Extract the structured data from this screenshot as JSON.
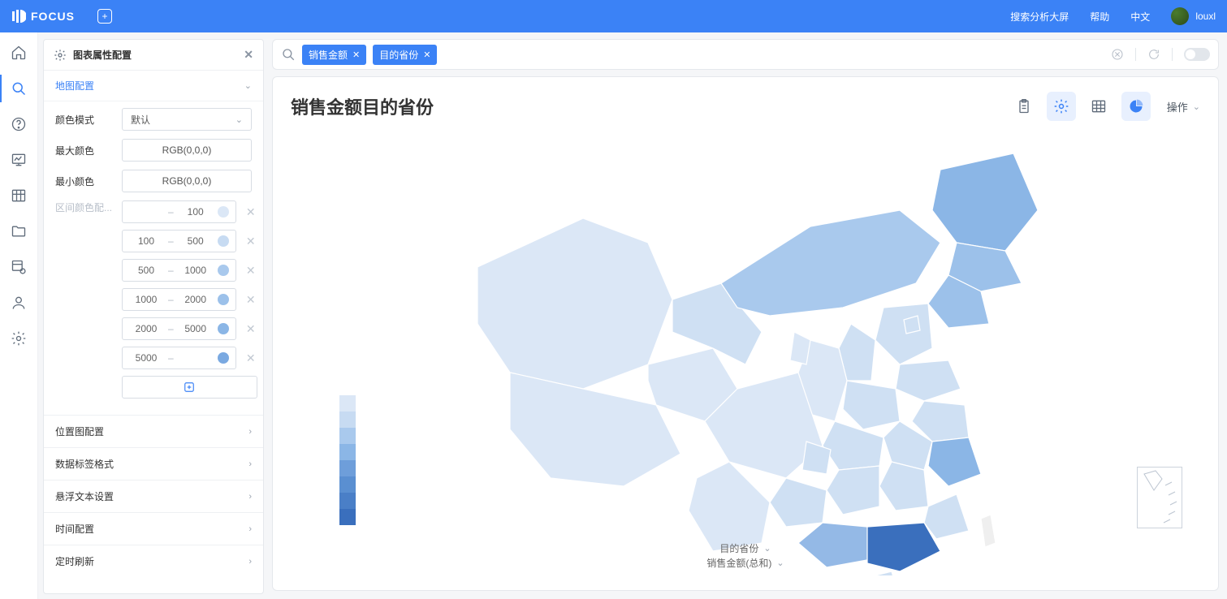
{
  "topbar": {
    "brand": "FOCUS",
    "links": {
      "search_screen": "搜索分析大屏",
      "help": "帮助",
      "lang": "中文"
    },
    "username": "louxl"
  },
  "panel": {
    "title": "图表属性配置",
    "map_config": "地图配置",
    "color_mode_label": "颜色模式",
    "color_mode_value": "默认",
    "max_color_label": "最大颜色",
    "max_color_value": "RGB(0,0,0)",
    "min_color_label": "最小颜色",
    "min_color_value": "RGB(0,0,0)",
    "interval_label": "区间颜色配...",
    "ranges": [
      {
        "from": "",
        "to": "100",
        "color": "#dbe7f6"
      },
      {
        "from": "100",
        "to": "500",
        "color": "#c7dbf2"
      },
      {
        "from": "500",
        "to": "1000",
        "color": "#a9c9ed"
      },
      {
        "from": "1000",
        "to": "2000",
        "color": "#9cc1ea"
      },
      {
        "from": "2000",
        "to": "5000",
        "color": "#8bb6e6"
      },
      {
        "from": "5000",
        "to": "",
        "color": "#7aa9e1"
      }
    ],
    "collapse": {
      "position": "位置图配置",
      "datalabel": "数据标签格式",
      "hover": "悬浮文本设置",
      "time": "时间配置",
      "refresh": "定时刷新"
    }
  },
  "search": {
    "chips": [
      {
        "label": "销售金额"
      },
      {
        "label": "目的省份"
      }
    ]
  },
  "canvas": {
    "title": "销售金额目的省份",
    "operate_label": "操作",
    "bottom": {
      "dim": "目的省份",
      "measure": "销售金额(总和)"
    },
    "legend_colors": [
      "#dbe7f6",
      "#c7dbf2",
      "#a9c9ed",
      "#8bb6e6",
      "#6e9eda",
      "#5a8fd1",
      "#4a7fc7",
      "#3a6fbd"
    ]
  },
  "chart_data": {
    "type": "choropleth",
    "title": "销售金额目的省份",
    "dimension": "目的省份",
    "measure": "销售金额(总和)",
    "color_ranges": [
      {
        "min": null,
        "max": 100
      },
      {
        "min": 100,
        "max": 500
      },
      {
        "min": 500,
        "max": 1000
      },
      {
        "min": 1000,
        "max": 2000
      },
      {
        "min": 2000,
        "max": 5000
      },
      {
        "min": 5000,
        "max": null
      }
    ],
    "regions": [
      {
        "name": "广东",
        "level": 7
      },
      {
        "name": "黑龙江",
        "level": 5
      },
      {
        "name": "辽宁",
        "level": 4
      },
      {
        "name": "吉林",
        "level": 4
      },
      {
        "name": "内蒙古",
        "level": 3
      },
      {
        "name": "广西",
        "level": 4
      },
      {
        "name": "浙江",
        "level": 4
      },
      {
        "name": "河北",
        "level": 2
      },
      {
        "name": "山东",
        "level": 2
      },
      {
        "name": "山西",
        "level": 2
      },
      {
        "name": "河南",
        "level": 2
      },
      {
        "name": "江苏",
        "level": 2
      },
      {
        "name": "安徽",
        "level": 2
      },
      {
        "name": "湖北",
        "level": 2
      },
      {
        "name": "湖南",
        "level": 2
      },
      {
        "name": "江西",
        "level": 2
      },
      {
        "name": "福建",
        "level": 2
      },
      {
        "name": "陕西",
        "level": 1
      },
      {
        "name": "甘肃",
        "level": 2
      },
      {
        "name": "宁夏",
        "level": 1
      },
      {
        "name": "四川",
        "level": 1
      },
      {
        "name": "重庆",
        "level": 2
      },
      {
        "name": "贵州",
        "level": 2
      },
      {
        "name": "云南",
        "level": 1
      },
      {
        "name": "青海",
        "level": 1
      },
      {
        "name": "西藏",
        "level": 1
      },
      {
        "name": "新疆",
        "level": 1
      },
      {
        "name": "北京",
        "level": 2
      },
      {
        "name": "天津",
        "level": 2
      },
      {
        "name": "上海",
        "level": 2
      },
      {
        "name": "海南",
        "level": 2
      },
      {
        "name": "台湾",
        "level": 0
      }
    ]
  }
}
